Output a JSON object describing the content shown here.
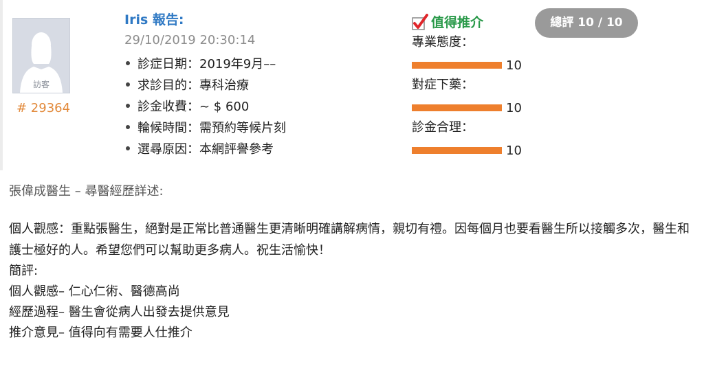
{
  "reviewer": {
    "name_line": "Iris 報告:",
    "timestamp": "29/10/2019 20:30:14"
  },
  "user": {
    "avatar_caption": "訪客",
    "id": "# 29364"
  },
  "details": [
    {
      "label": "診症日期：",
      "value": "2019年9月––"
    },
    {
      "label": "求診目的：",
      "value": "專科治療"
    },
    {
      "label": "診金收費：",
      "value": "~ $ 600"
    },
    {
      "label": "輪候時間：",
      "value": "需預約等候片刻"
    },
    {
      "label": "選尋原因：",
      "value": "本網評譽參考"
    }
  ],
  "recommend": {
    "label": "值得推介",
    "icon": "checkmark-icon",
    "color": "#2a9a4a"
  },
  "overall": {
    "label": "總評 10 / 10"
  },
  "ratings": [
    {
      "label": "專業態度：",
      "value": "10",
      "score": 10,
      "max": 10
    },
    {
      "label": "對症下藥：",
      "value": "10",
      "score": 10,
      "max": 10
    },
    {
      "label": "診金合理：",
      "value": "10",
      "score": 10,
      "max": 10
    }
  ],
  "colors": {
    "bar": "#ee7f2d",
    "accent": "#2f79c4",
    "id": "#e2893a"
  },
  "section_title": "張偉成醫生 – 尋醫經歷詳述:",
  "comment": "個人觀感：重點張醫生，絕對是正常比普通醫生更清晰明確講解病情，親切有禮。因每個月也要看醫生所以接觸多次，醫生和護士極好的人。希望您們可以幫助更多病人。祝生活愉快！",
  "summary": {
    "heading": "簡評:",
    "lines": [
      "個人觀感– 仁心仁術、醫德高尚",
      "經歷過程– 醫生會從病人出發去提供意見",
      "推介意見– 值得向有需要人仕推介"
    ]
  }
}
